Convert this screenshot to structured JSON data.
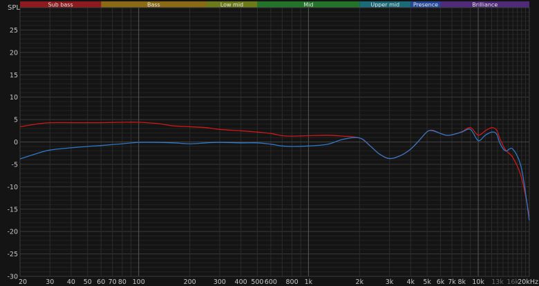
{
  "chart_data": {
    "type": "line",
    "ylabel": "SPL",
    "x_scale": "log",
    "xlim": [
      20,
      20000
    ],
    "ylim": [
      -30,
      30
    ],
    "grid": true,
    "x_ticks": [
      {
        "v": 20,
        "label": "20"
      },
      {
        "v": 30,
        "label": "30"
      },
      {
        "v": 40,
        "label": "40"
      },
      {
        "v": 50,
        "label": "50"
      },
      {
        "v": 60,
        "label": "60"
      },
      {
        "v": 70,
        "label": "70"
      },
      {
        "v": 80,
        "label": "80"
      },
      {
        "v": 100,
        "label": "100"
      },
      {
        "v": 200,
        "label": "200"
      },
      {
        "v": 300,
        "label": "300"
      },
      {
        "v": 400,
        "label": "400"
      },
      {
        "v": 500,
        "label": "500"
      },
      {
        "v": 600,
        "label": "600"
      },
      {
        "v": 800,
        "label": "800"
      },
      {
        "v": 1000,
        "label": "1k"
      },
      {
        "v": 2000,
        "label": "2k"
      },
      {
        "v": 3000,
        "label": "3k"
      },
      {
        "v": 4000,
        "label": "4k"
      },
      {
        "v": 5000,
        "label": "5k"
      },
      {
        "v": 6000,
        "label": "6k"
      },
      {
        "v": 7000,
        "label": "7k"
      },
      {
        "v": 8000,
        "label": "8k"
      },
      {
        "v": 10000,
        "label": "10k"
      },
      {
        "v": 13000,
        "label": "13k",
        "dim": true
      },
      {
        "v": 16000,
        "label": "16k",
        "dim": true
      },
      {
        "v": 20000,
        "label": "20kHz"
      }
    ],
    "y_ticks": [
      25,
      20,
      15,
      10,
      5,
      0,
      -5,
      -10,
      -15,
      -20,
      -25,
      -30
    ],
    "bands": [
      {
        "label": "Sub bass",
        "from": 20,
        "to": 60,
        "color": "#8c1a1e"
      },
      {
        "label": "Bass",
        "from": 60,
        "to": 250,
        "color": "#8a6a14"
      },
      {
        "label": "Low mid",
        "from": 250,
        "to": 500,
        "color": "#6d7a1a"
      },
      {
        "label": "Mid",
        "from": 500,
        "to": 2000,
        "color": "#23742a"
      },
      {
        "label": "Upper mid",
        "from": 2000,
        "to": 4000,
        "color": "#1b6a78"
      },
      {
        "label": "Presence",
        "from": 4000,
        "to": 6000,
        "color": "#24489a"
      },
      {
        "label": "Brilliance",
        "from": 6000,
        "to": 20000,
        "color": "#4e2a78"
      }
    ],
    "series": [
      {
        "color": "#d01818",
        "points": [
          [
            20,
            3.4
          ],
          [
            25,
            4.0
          ],
          [
            30,
            4.3
          ],
          [
            40,
            4.3
          ],
          [
            50,
            4.3
          ],
          [
            60,
            4.3
          ],
          [
            80,
            4.4
          ],
          [
            100,
            4.4
          ],
          [
            130,
            4.1
          ],
          [
            160,
            3.6
          ],
          [
            200,
            3.4
          ],
          [
            250,
            3.2
          ],
          [
            300,
            2.8
          ],
          [
            400,
            2.5
          ],
          [
            500,
            2.2
          ],
          [
            600,
            1.9
          ],
          [
            700,
            1.4
          ],
          [
            800,
            1.3
          ],
          [
            1000,
            1.4
          ],
          [
            1300,
            1.5
          ],
          [
            1600,
            1.3
          ],
          [
            2000,
            0.9
          ],
          [
            2300,
            -0.8
          ],
          [
            2600,
            -2.6
          ],
          [
            3000,
            -3.7
          ],
          [
            3500,
            -3.0
          ],
          [
            4000,
            -1.6
          ],
          [
            4500,
            0.4
          ],
          [
            5000,
            2.3
          ],
          [
            5400,
            2.6
          ],
          [
            6000,
            1.9
          ],
          [
            6500,
            1.5
          ],
          [
            7000,
            1.6
          ],
          [
            8000,
            2.3
          ],
          [
            9000,
            3.2
          ],
          [
            10000,
            1.5
          ],
          [
            11000,
            2.5
          ],
          [
            12000,
            3.2
          ],
          [
            12800,
            2.7
          ],
          [
            13500,
            0.5
          ],
          [
            14500,
            -1.8
          ],
          [
            16000,
            -3.5
          ],
          [
            18000,
            -8.0
          ],
          [
            20000,
            -16.5
          ]
        ]
      },
      {
        "color": "#2f78c8",
        "points": [
          [
            20,
            -3.8
          ],
          [
            25,
            -2.6
          ],
          [
            30,
            -1.8
          ],
          [
            40,
            -1.3
          ],
          [
            50,
            -1.0
          ],
          [
            60,
            -0.8
          ],
          [
            80,
            -0.4
          ],
          [
            100,
            -0.1
          ],
          [
            130,
            -0.1
          ],
          [
            160,
            -0.2
          ],
          [
            200,
            -0.4
          ],
          [
            250,
            -0.2
          ],
          [
            300,
            -0.1
          ],
          [
            400,
            -0.2
          ],
          [
            500,
            -0.2
          ],
          [
            600,
            -0.5
          ],
          [
            700,
            -0.9
          ],
          [
            800,
            -1.0
          ],
          [
            1000,
            -0.9
          ],
          [
            1300,
            -0.5
          ],
          [
            1600,
            0.6
          ],
          [
            2000,
            0.9
          ],
          [
            2300,
            -0.8
          ],
          [
            2600,
            -2.6
          ],
          [
            3000,
            -3.7
          ],
          [
            3500,
            -3.0
          ],
          [
            4000,
            -1.6
          ],
          [
            4500,
            0.4
          ],
          [
            5000,
            2.3
          ],
          [
            5400,
            2.5
          ],
          [
            6000,
            1.9
          ],
          [
            6500,
            1.5
          ],
          [
            7000,
            1.6
          ],
          [
            8000,
            2.2
          ],
          [
            9000,
            2.8
          ],
          [
            10000,
            0.3
          ],
          [
            11000,
            1.5
          ],
          [
            12000,
            2.2
          ],
          [
            12800,
            1.8
          ],
          [
            13500,
            -0.5
          ],
          [
            14500,
            -2.0
          ],
          [
            16000,
            -1.6
          ],
          [
            18000,
            -6.0
          ],
          [
            20000,
            -17.5
          ]
        ]
      }
    ]
  }
}
